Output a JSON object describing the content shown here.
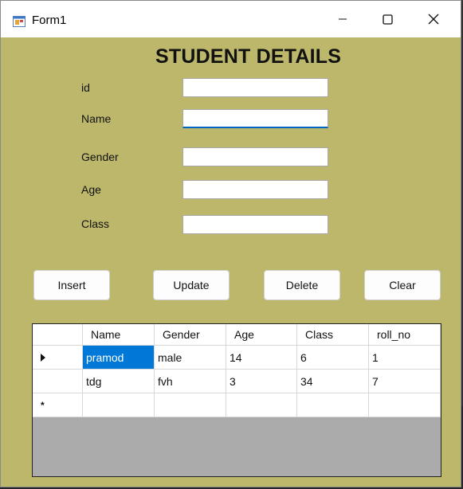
{
  "window": {
    "title": "Form1"
  },
  "form": {
    "heading": "STUDENT DETAILS",
    "fields": [
      {
        "label": "id",
        "value": ""
      },
      {
        "label": "Name",
        "value": ""
      },
      {
        "label": "Gender",
        "value": ""
      },
      {
        "label": "Age",
        "value": ""
      },
      {
        "label": "Class",
        "value": ""
      }
    ]
  },
  "buttons": {
    "insert": "Insert",
    "update": "Update",
    "delete": "Delete",
    "clear": "Clear"
  },
  "grid": {
    "columns": [
      "Name",
      "Gender",
      "Age",
      "Class",
      "roll_no"
    ],
    "rows": [
      [
        "pramod",
        "male",
        "14",
        "6",
        "1"
      ],
      [
        "tdg",
        "fvh",
        "3",
        "34",
        "7"
      ]
    ],
    "new_row_marker": "*"
  },
  "colors": {
    "form_background": "#bdb76b",
    "selection": "#0078d7",
    "grid_background": "#ababab"
  },
  "icons": [
    "app-icon",
    "minimize-icon",
    "maximize-icon",
    "close-icon",
    "current-row-arrow-icon",
    "new-row-star-icon"
  ]
}
